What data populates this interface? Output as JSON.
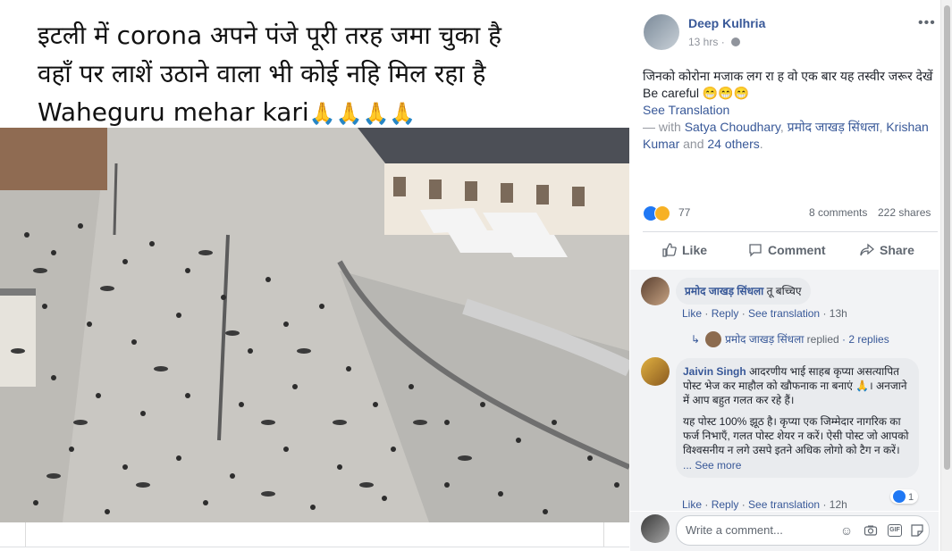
{
  "image_caption": {
    "lines": [
      "इटली में corona अपने पंजे पूरी तरह जमा चुका है",
      "वहाँ पर लाशें उठाने वाला भी कोई नहि मिल रहा है",
      "Waheguru mehar kari"
    ],
    "emoji": "🙏🙏🙏🙏"
  },
  "post": {
    "author": "Deep Kulhria",
    "time": "13 hrs",
    "privacy_icon": "globe-icon",
    "more_label": "•••",
    "text_line1": "जिनको कोरोना मजाक लग रा ह वो एक बार यह तस्वीर जरूर देखें",
    "text_line2": "Be careful 😁😁😁",
    "see_translation": "See Translation",
    "with_prefix": "— with ",
    "tag1": "Satya Choudhary",
    "tag2": "प्रमोद जाखड़ सिंधला",
    "tag3": "Krishan Kumar",
    "and_label": " and ",
    "others": "24 others",
    "period": "."
  },
  "stats": {
    "reactions": "77",
    "comments": "8 comments",
    "shares": "222 shares"
  },
  "actions": {
    "like": "Like",
    "comment": "Comment",
    "share": "Share"
  },
  "comments": [
    {
      "name": "प्रमोद जाखड़ सिंधला",
      "text": "तू बच्चिए",
      "like": "Like",
      "reply": "Reply",
      "translate": "See translation",
      "time": "13h",
      "reply_author": "प्रमोद जाखड़ सिंधला",
      "reply_label": "replied",
      "reply_count": "2 replies"
    },
    {
      "name": "Jaivin Singh",
      "text_p1": "आदरणीय भाई साहब कृप्या असत्यापित पोस्ट भेज कर माहौल को खौफनाक ना बनाएं 🙏। अनजाने में आप बहुत गलत कर रहे हैं।",
      "text_p2": "यह पोस्ट 100% झूठ है। कृप्या एक जिम्मेदार नागरिक का फर्ज निभाएँ, गलत पोस्ट शेयर न करें। ऐसी पोस्ट जो आपको विश्वसनीय न लगे उसपे इतने अधिक लोगो को टैग न करें।",
      "see_more": "... See more",
      "likes": "1",
      "like": "Like",
      "reply": "Reply",
      "translate": "See translation",
      "time": "12h"
    }
  ],
  "composer": {
    "placeholder": "Write a comment...",
    "tools": [
      "emoji-icon",
      "camera-icon",
      "gif-icon",
      "sticker-icon"
    ],
    "gif_label": "GIF"
  },
  "colors": {
    "link": "#385898",
    "muted": "#90949c",
    "like_blue": "#2078f4",
    "comment_bg": "#f2f3f5"
  }
}
